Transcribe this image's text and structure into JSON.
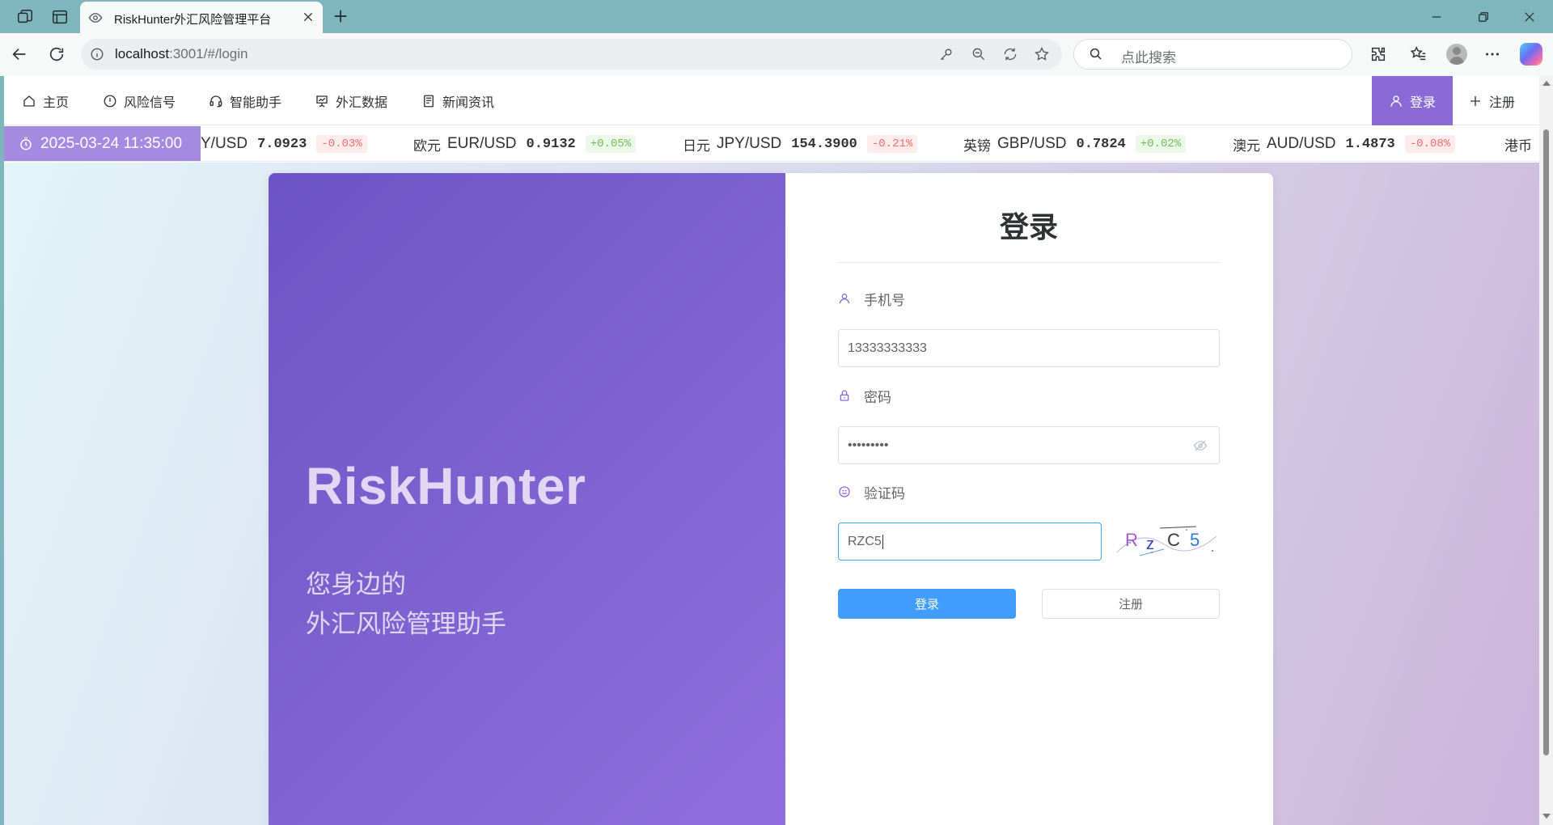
{
  "browser": {
    "tab_title": "RiskHunter外汇风险管理平台",
    "address": {
      "host": "localhost",
      "path": ":3001/#/login"
    },
    "search_placeholder": "点此搜索"
  },
  "nav": {
    "items": [
      {
        "label": "主页",
        "icon": "home-icon"
      },
      {
        "label": "风险信号",
        "icon": "alert-circle-icon"
      },
      {
        "label": "智能助手",
        "icon": "headset-icon"
      },
      {
        "label": "外汇数据",
        "icon": "chart-board-icon"
      },
      {
        "label": "新闻资讯",
        "icon": "news-icon"
      }
    ],
    "login_label": "登录",
    "register_label": "注册"
  },
  "ticker": {
    "time": "2025-03-24 11:35:00",
    "items": [
      {
        "name": "",
        "pair": "Y/USD",
        "price": "7.0923",
        "change": "-0.03%",
        "dir": "down"
      },
      {
        "name": "欧元",
        "pair": "EUR/USD",
        "price": "0.9132",
        "change": "+0.05%",
        "dir": "up"
      },
      {
        "name": "日元",
        "pair": "JPY/USD",
        "price": "154.3900",
        "change": "-0.21%",
        "dir": "down"
      },
      {
        "name": "英镑",
        "pair": "GBP/USD",
        "price": "0.7824",
        "change": "+0.02%",
        "dir": "up"
      },
      {
        "name": "澳元",
        "pair": "AUD/USD",
        "price": "1.4873",
        "change": "-0.08%",
        "dir": "down"
      },
      {
        "name": "港币",
        "pair": "",
        "price": "",
        "change": "",
        "dir": ""
      }
    ]
  },
  "hero": {
    "title": "RiskHunter",
    "subtitle_line1": "您身边的",
    "subtitle_line2": "外汇风险管理助手"
  },
  "form": {
    "title": "登录",
    "phone_label": "手机号",
    "phone_value": "13333333333",
    "password_label": "密码",
    "password_value": "•••••••••",
    "captcha_label": "验证码",
    "captcha_value": "RZC5",
    "captcha_image_text": "RzC5",
    "login_button": "登录",
    "register_button": "注册"
  },
  "colors": {
    "accent_purple": "#8a6bd6",
    "primary_blue": "#409eff",
    "up_green": "#6ec154",
    "down_red": "#f26c6c"
  }
}
